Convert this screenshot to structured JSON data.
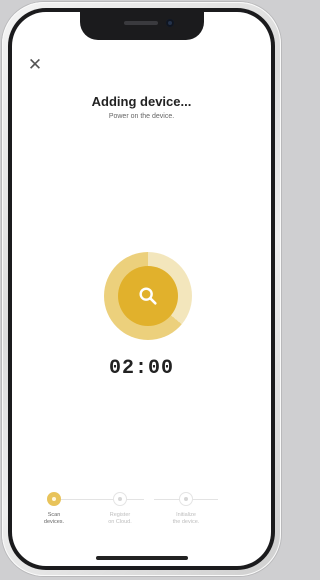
{
  "header": {
    "close_glyph": "✕",
    "title": "Adding device...",
    "subtitle": "Power on the device."
  },
  "scan": {
    "icon": "search-icon",
    "accent_color": "#e1b12c",
    "timer": "02:00"
  },
  "steps": [
    {
      "label_line1": "Scan",
      "label_line2": "devices.",
      "state": "active"
    },
    {
      "label_line1": "Register",
      "label_line2": "on Cloud.",
      "state": "pending"
    },
    {
      "label_line1": "Initialize",
      "label_line2": "the device.",
      "state": "pending"
    }
  ]
}
